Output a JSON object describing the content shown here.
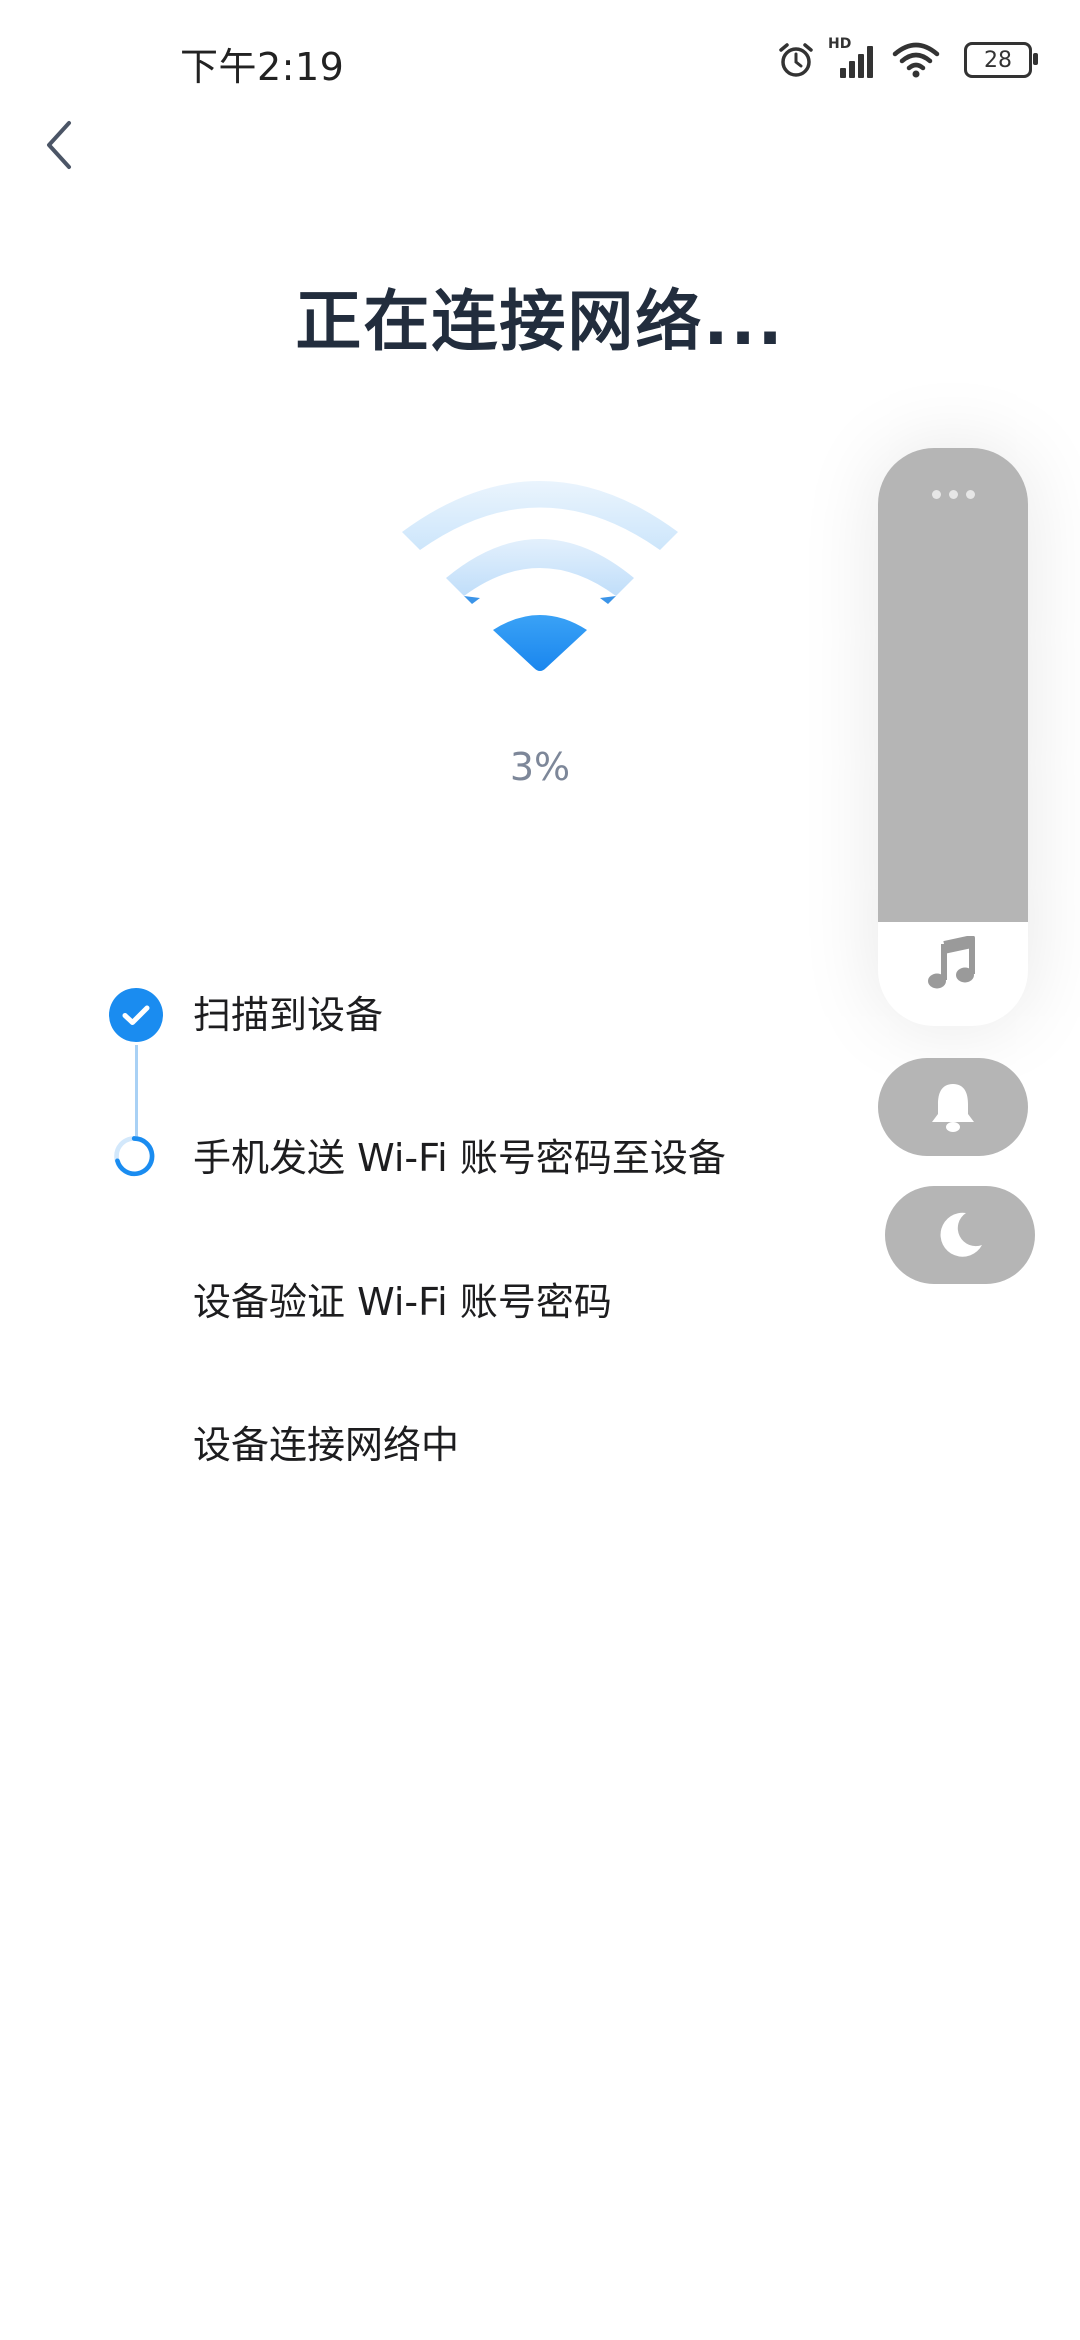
{
  "status_bar": {
    "time": "下午2:19",
    "network_label": "HD",
    "battery": "28"
  },
  "header": {
    "title": "正在连接网络..."
  },
  "progress": {
    "percent_label": "3%",
    "value": 0.03
  },
  "steps": [
    {
      "label": "扫描到设备",
      "state": "done"
    },
    {
      "label": "手机发送 Wi-Fi 账号密码至设备",
      "state": "in_progress"
    },
    {
      "label": "设备验证 Wi-Fi 账号密码",
      "state": "pending"
    },
    {
      "label": "设备连接网络中",
      "state": "pending"
    }
  ],
  "volume_overlay": {
    "level": 0.18,
    "icons": [
      "more-icon",
      "music-note-icon",
      "bell-icon",
      "moon-icon"
    ]
  },
  "colors": {
    "accent": "#1a8cf0",
    "accent_light": "#a9d1f5",
    "title": "#222d3d",
    "overlay_gray": "#b5b5b5"
  }
}
